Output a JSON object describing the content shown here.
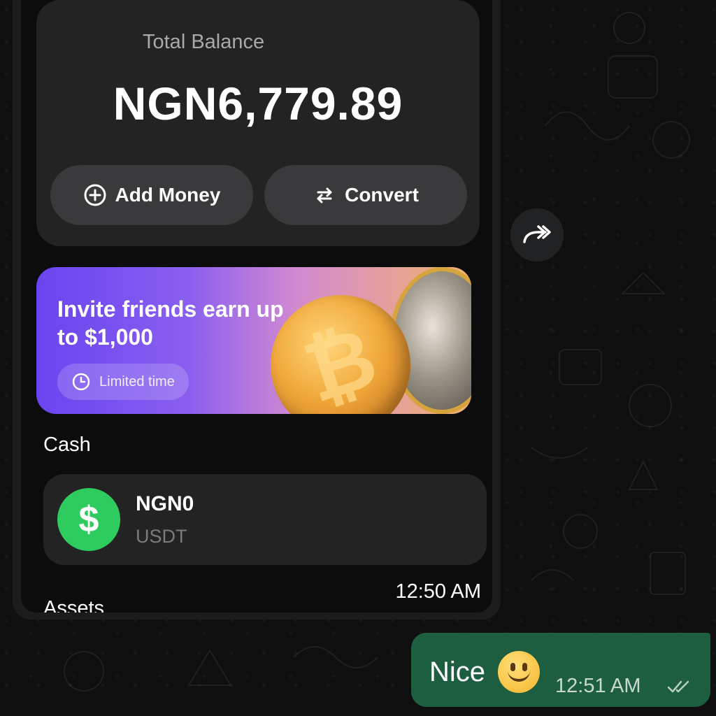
{
  "image_message": {
    "total_balance_label": "Total Balance",
    "total_balance_value": "NGN6,779.89",
    "add_money_label": "Add Money",
    "convert_label": "Convert",
    "promo": {
      "title": "Invite friends earn up to $1,000",
      "badge": "Limited time"
    },
    "cash_section_title": "Cash",
    "cash_item": {
      "amount": "NGN0",
      "currency": "USDT",
      "icon_symbol": "$"
    },
    "assets_section_title": "Assets",
    "timestamp": "12:50 AM"
  },
  "reply_message": {
    "text": "Nice",
    "emoji": "slightly-smiling-face",
    "timestamp": "12:51 AM",
    "status": "read"
  },
  "icons": {
    "forward": "forward-icon",
    "add": "plus-circle-icon",
    "convert": "swap-arrows-icon",
    "clock": "clock-icon",
    "read_ticks": "double-check-icon"
  },
  "colors": {
    "outgoing_bubble": "#1d5d40",
    "cash_icon": "#2ecc5f",
    "card_bg": "#232324",
    "wallpaper": "#0f0f10"
  }
}
